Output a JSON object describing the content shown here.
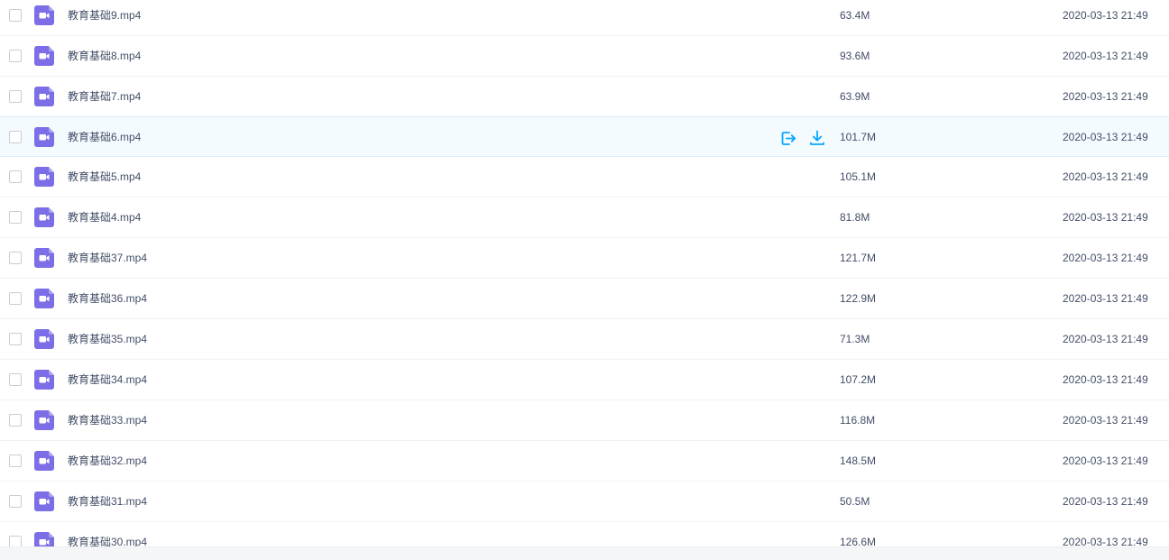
{
  "colors": {
    "video_icon": "#7c6ee6",
    "action_icon": "#06a7ff",
    "hover_row_bg": "#f4fbff",
    "text": "#424e67"
  },
  "icons": {
    "file_type": "video-file-icon",
    "share": "share-icon",
    "download": "download-icon"
  },
  "files": [
    {
      "name": "教育基础9.mp4",
      "size": "63.4M",
      "date": "2020-03-13 21:49"
    },
    {
      "name": "教育基础8.mp4",
      "size": "93.6M",
      "date": "2020-03-13 21:49"
    },
    {
      "name": "教育基础7.mp4",
      "size": "63.9M",
      "date": "2020-03-13 21:49"
    },
    {
      "name": "教育基础6.mp4",
      "size": "101.7M",
      "date": "2020-03-13 21:49",
      "hovered": true
    },
    {
      "name": "教育基础5.mp4",
      "size": "105.1M",
      "date": "2020-03-13 21:49"
    },
    {
      "name": "教育基础4.mp4",
      "size": "81.8M",
      "date": "2020-03-13 21:49"
    },
    {
      "name": "教育基础37.mp4",
      "size": "121.7M",
      "date": "2020-03-13 21:49"
    },
    {
      "name": "教育基础36.mp4",
      "size": "122.9M",
      "date": "2020-03-13 21:49"
    },
    {
      "name": "教育基础35.mp4",
      "size": "71.3M",
      "date": "2020-03-13 21:49"
    },
    {
      "name": "教育基础34.mp4",
      "size": "107.2M",
      "date": "2020-03-13 21:49"
    },
    {
      "name": "教育基础33.mp4",
      "size": "116.8M",
      "date": "2020-03-13 21:49"
    },
    {
      "name": "教育基础32.mp4",
      "size": "148.5M",
      "date": "2020-03-13 21:49"
    },
    {
      "name": "教育基础31.mp4",
      "size": "50.5M",
      "date": "2020-03-13 21:49"
    },
    {
      "name": "教育基础30.mp4",
      "size": "126.6M",
      "date": "2020-03-13 21:49"
    }
  ]
}
